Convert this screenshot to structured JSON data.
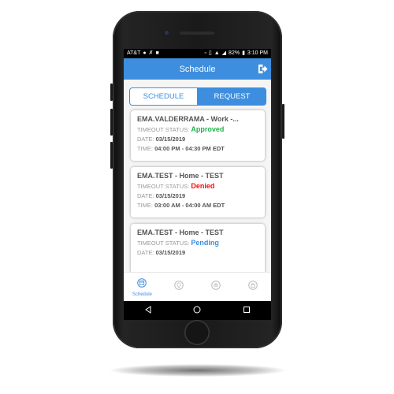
{
  "status_bar": {
    "carrier": "AT&T",
    "battery": "82%",
    "time": "3:10 PM"
  },
  "app_bar": {
    "title": "Schedule"
  },
  "tabs": [
    {
      "label": "SCHEDULE",
      "active": false
    },
    {
      "label": "REQUEST",
      "active": true
    }
  ],
  "labels": {
    "timeout_status": "TIMEOUT STATUS:",
    "date": "DATE:",
    "time": "TIME:"
  },
  "requests": [
    {
      "title": "EMA.VALDERRAMA - Work -...",
      "status": "Approved",
      "status_color": "#22b14c",
      "date": "03/15/2019",
      "time": "04:00 PM - 04:30 PM EDT"
    },
    {
      "title": "EMA.TEST - Home - TEST",
      "status": "Denied",
      "status_color": "#ee1111",
      "date": "03/15/2019",
      "time": "03:00 AM - 04:00 AM EDT"
    },
    {
      "title": "EMA.TEST - Home - TEST",
      "status": "Pending",
      "status_color": "#3d8ede",
      "date": "03/15/2019"
    }
  ],
  "bottom_nav": [
    {
      "label": "Schedule",
      "icon": "calendar-icon",
      "active": true
    },
    {
      "icon": "location-icon"
    },
    {
      "icon": "fingerprint-icon"
    },
    {
      "icon": "lock-icon"
    }
  ],
  "colors": {
    "primary": "#3d8ede",
    "approved": "#22b14c",
    "denied": "#ee1111",
    "pending": "#3d8ede"
  }
}
